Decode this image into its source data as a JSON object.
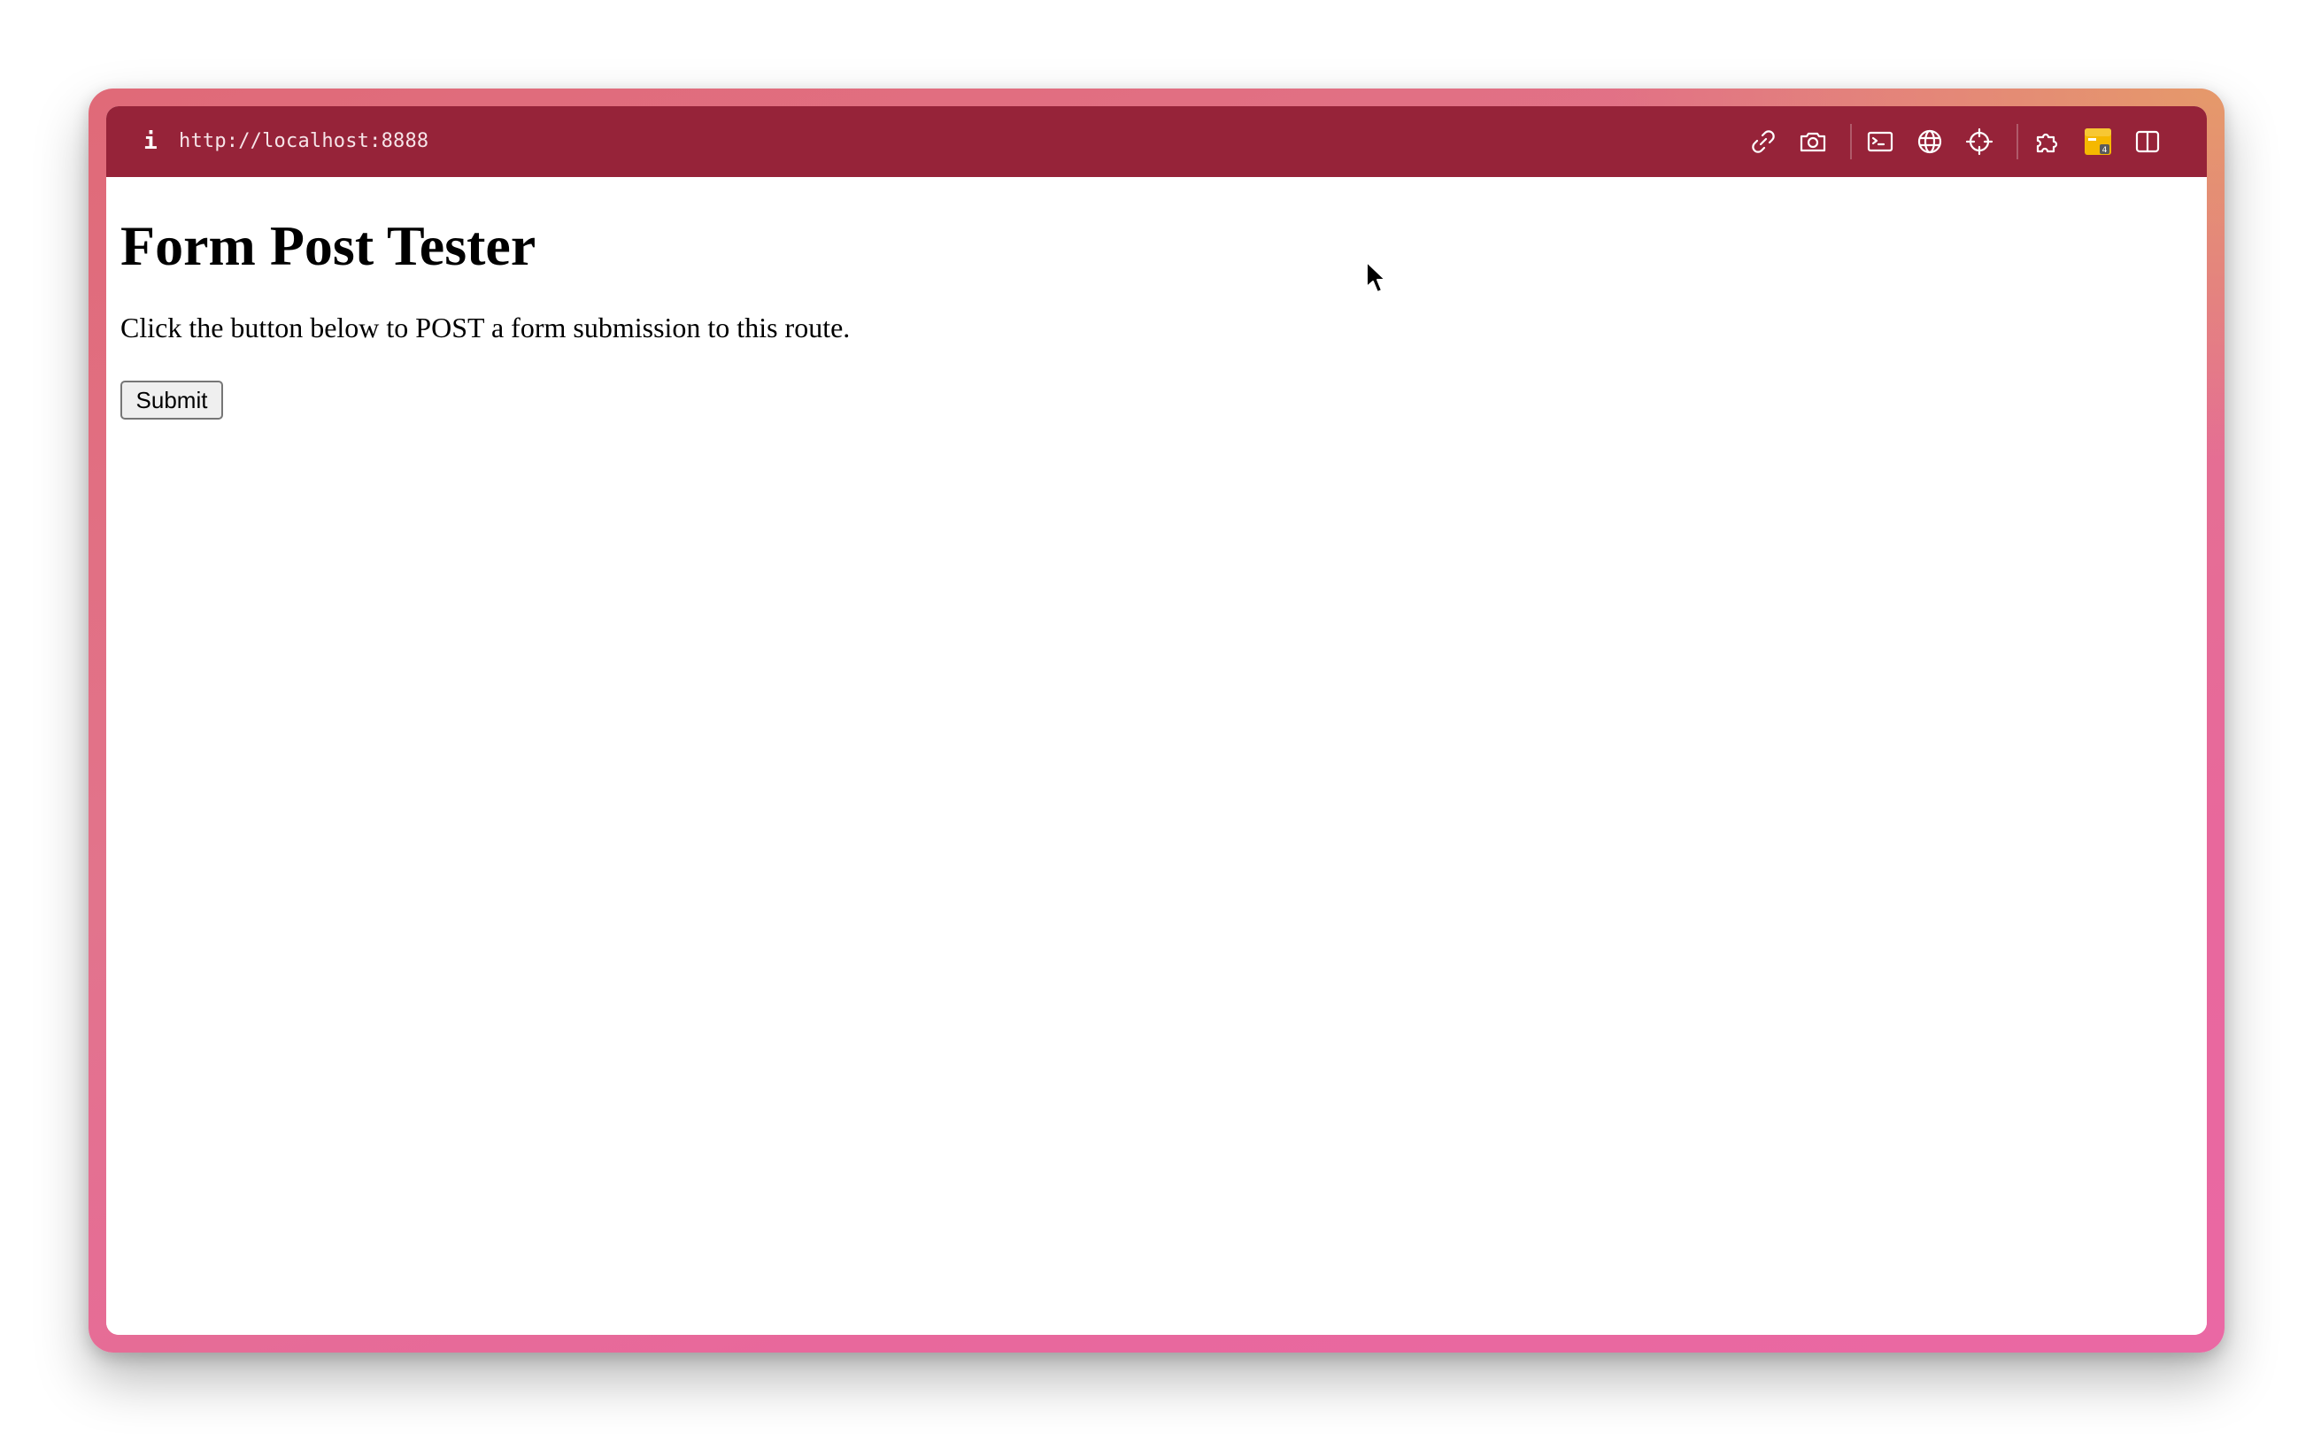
{
  "browser": {
    "url": "http://localhost:8888",
    "info_icon": "info-icon",
    "toolbar_color": "#962339",
    "toolbar_icons": [
      "link-icon",
      "camera-icon",
      "terminal-icon",
      "globe-icon",
      "crosshair-icon",
      "extensions-icon",
      "extension-badge-icon",
      "sidebar-toggle-icon"
    ],
    "extension_badge_color": "#f5b800"
  },
  "page": {
    "title": "Form Post Tester",
    "description": "Click the button below to POST a form submission to this route.",
    "submit_label": "Submit"
  }
}
